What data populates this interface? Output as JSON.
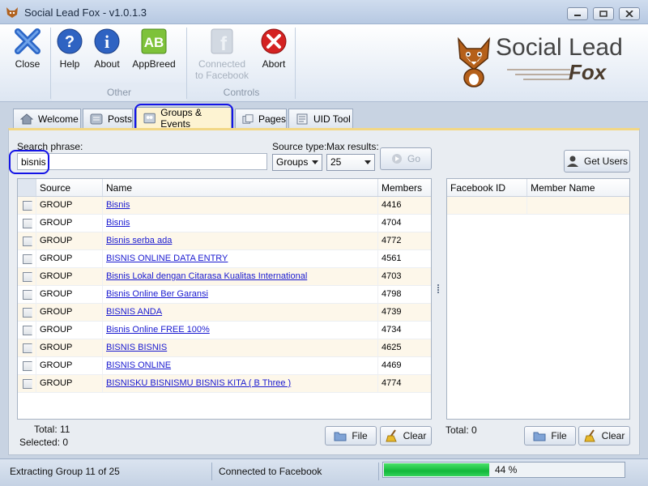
{
  "window": {
    "title": "Social Lead Fox - v1.0.1.3"
  },
  "ribbon": {
    "buttons": [
      {
        "id": "close",
        "label": "Close",
        "icon": "close-x-icon"
      },
      {
        "id": "help",
        "label": "Help",
        "icon": "help-question-icon"
      },
      {
        "id": "about",
        "label": "About",
        "icon": "info-icon"
      },
      {
        "id": "appbreed",
        "label": "AppBreed",
        "icon": "appbreed-icon"
      },
      {
        "id": "connect",
        "label": "Connected\nto Facebook",
        "label_line1": "Connected",
        "label_line2": "to Facebook",
        "icon": "facebook-icon"
      },
      {
        "id": "abort",
        "label": "Abort",
        "icon": "abort-icon"
      }
    ],
    "groups": {
      "other": "Other",
      "controls": "Controls"
    }
  },
  "logo": {
    "line1": "Social Lead",
    "line2": "Fox"
  },
  "tabs": [
    {
      "label": "Welcome",
      "icon": "home-icon"
    },
    {
      "label": "Posts",
      "icon": "posts-icon"
    },
    {
      "label": "Groups & Events",
      "icon": "groups-icon"
    },
    {
      "label": "Pages",
      "icon": "pages-icon"
    },
    {
      "label": "UID Tool",
      "icon": "uid-tool-icon"
    }
  ],
  "search": {
    "phrase_label": "Search phrase:",
    "phrase_value": "bisnis",
    "source_type_label": "Source type:",
    "source_type_value": "Groups",
    "max_results_label": "Max results:",
    "max_results_value": "25",
    "go_label": "Go",
    "get_users_label": "Get Users"
  },
  "results_table": {
    "columns": [
      "Source",
      "Name",
      "Members"
    ],
    "rows": [
      {
        "source": "GROUP",
        "name": "Bisnis",
        "members": "4416"
      },
      {
        "source": "GROUP",
        "name": "Bisnis",
        "members": "4704"
      },
      {
        "source": "GROUP",
        "name": "Bisnis serba ada",
        "members": "4772"
      },
      {
        "source": "GROUP",
        "name": "BISNIS ONLINE DATA ENTRY",
        "members": "4561"
      },
      {
        "source": "GROUP",
        "name": "Bisnis Lokal dengan Citarasa  Kualitas International",
        "members": "4703"
      },
      {
        "source": "GROUP",
        "name": "Bisnis Online Ber Garansi",
        "members": "4798"
      },
      {
        "source": "GROUP",
        "name": "BISNIS ANDA",
        "members": "4739"
      },
      {
        "source": "GROUP",
        "name": "Bisnis Online FREE 100%",
        "members": "4734"
      },
      {
        "source": "GROUP",
        "name": "BISNIS  BISNIS",
        "members": "4625"
      },
      {
        "source": "GROUP",
        "name": "BISNIS ONLINE",
        "members": "4469"
      },
      {
        "source": "GROUP",
        "name": "BISNISKU BISNISMU BISNIS KITA ( B Three )",
        "members": "4774"
      }
    ],
    "total_label": "Total: 11",
    "selected_label": "Selected: 0",
    "file_label": "File",
    "clear_label": "Clear"
  },
  "users_table": {
    "columns": [
      "Facebook ID",
      "Member Name"
    ],
    "total_label": "Total: 0",
    "file_label": "File",
    "clear_label": "Clear"
  },
  "status": {
    "left": "Extracting Group 11 of 25",
    "middle": "Connected to Facebook",
    "progress_value": 44,
    "progress_text": "44 %"
  },
  "colors": {
    "accent_tab": "#fdf3d2",
    "link": "#1a1ad0",
    "annotation": "#1414e6",
    "progress": "#12b83a"
  }
}
